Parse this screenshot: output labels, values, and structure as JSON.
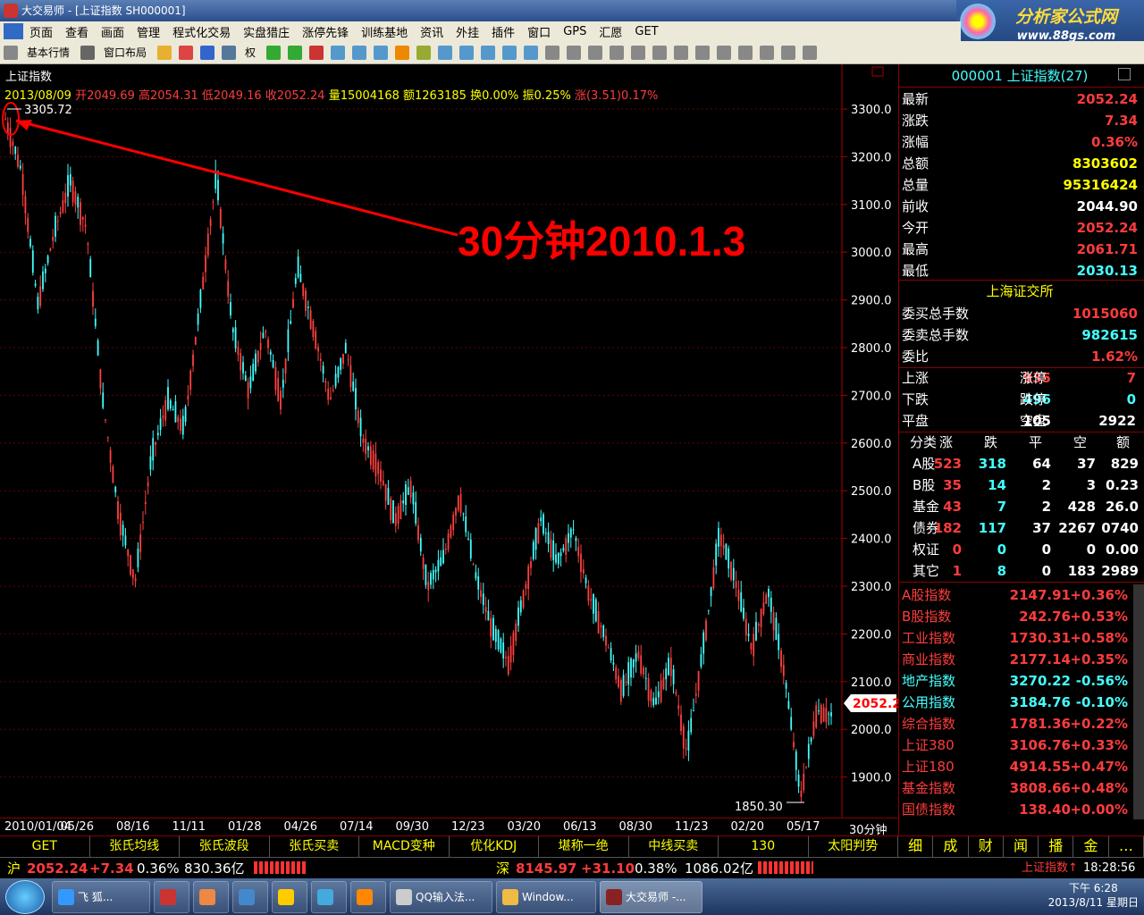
{
  "window": {
    "title": "大交易师 - [上证指数 SH000001]"
  },
  "logo": {
    "main": "分析家公式网",
    "url": "www.88gs.com"
  },
  "menu": [
    "页面",
    "查看",
    "画面",
    "管理",
    "程式化交易",
    "实盘猎庄",
    "涨停先锋",
    "训练基地",
    "资讯",
    "外挂",
    "插件",
    "窗口",
    "GPS",
    "汇愿",
    "GET"
  ],
  "toolbar": {
    "quotes": "基本行情",
    "layout": "窗口布局",
    "rights": "权"
  },
  "chart": {
    "title": "上证指数",
    "info": {
      "date": "2013/08/09",
      "open": "开2049.69",
      "high": "高2054.31",
      "low": "低2049.16",
      "close": "收2052.24",
      "vol": "量15004168",
      "amt": "额1263185",
      "turn": "换0.00%",
      "amp": "振0.25%",
      "chg": "涨(3.51)0.17%"
    },
    "annotation": "30分钟2010.1.3",
    "high_label": "3305.72",
    "low_label": "1850.30",
    "price_tag": "2052.2",
    "y_labels": [
      "3300.0",
      "3200.0",
      "3100.0",
      "3000.0",
      "2900.0",
      "2800.0",
      "2700.0",
      "2600.0",
      "2500.0",
      "2400.0",
      "2300.0",
      "2200.0",
      "2100.0",
      "2000.0",
      "1900.0"
    ],
    "x_labels": [
      "2010/01/04",
      "05/26",
      "08/16",
      "11/11",
      "01/28",
      "04/26",
      "07/14",
      "09/30",
      "12/23",
      "03/20",
      "06/13",
      "08/30",
      "11/23",
      "02/20",
      "05/17"
    ],
    "period": "30分钟"
  },
  "chart_data": {
    "type": "line",
    "title": "上证指数",
    "ylim": [
      1850,
      3320
    ],
    "x": [
      "2010/01/04",
      "05/26",
      "08/16",
      "11/11",
      "01/28",
      "04/26",
      "07/14",
      "09/30",
      "12/23",
      "03/20",
      "06/13",
      "08/30",
      "11/23",
      "02/20",
      "05/17"
    ],
    "series": [
      {
        "values": [
          3290,
          3180,
          2900,
          3050,
          3160,
          3060,
          2700,
          2460,
          2320,
          2580,
          2700,
          2640,
          2900,
          3170,
          2850,
          2720,
          2850,
          2700,
          2980,
          2850,
          2700,
          2810,
          2620,
          2560,
          2450,
          2520,
          2310,
          2370,
          2500,
          2330,
          2220,
          2150,
          2300,
          2450,
          2360,
          2430,
          2290,
          2200,
          2090,
          2170,
          2060,
          2150,
          1960,
          2180,
          2420,
          2320,
          2180,
          2300,
          2130,
          1870,
          2050,
          2040
        ]
      }
    ]
  },
  "right": {
    "header": "000001 上证指数(27)",
    "quote": [
      {
        "label": "最新",
        "value": "2052.24",
        "color": "red"
      },
      {
        "label": "涨跌",
        "value": "7.34",
        "color": "red"
      },
      {
        "label": "涨幅",
        "value": "0.36%",
        "color": "red"
      },
      {
        "label": "总额",
        "value": "8303602",
        "color": "yellow"
      },
      {
        "label": "总量",
        "value": "95316424",
        "color": "yellow"
      },
      {
        "label": "前收",
        "value": "2044.90",
        "color": "white"
      },
      {
        "label": "今开",
        "value": "2052.24",
        "color": "red"
      },
      {
        "label": "最高",
        "value": "2061.71",
        "color": "red"
      },
      {
        "label": "最低",
        "value": "2030.13",
        "color": "cyan"
      }
    ],
    "exchange": "上海证交所",
    "orders": [
      {
        "label": "委买总手数",
        "value": "1015060",
        "color": "red"
      },
      {
        "label": "委卖总手数",
        "value": "982615",
        "color": "cyan"
      },
      {
        "label": "委比",
        "value": "1.62%",
        "color": "red"
      }
    ],
    "breadth": [
      {
        "l1": "上涨",
        "v1": "935",
        "l2": "涨停",
        "v2": "7",
        "c": "red"
      },
      {
        "l1": "下跌",
        "v1": "496",
        "l2": "跌停",
        "v2": "0",
        "c": "cyan"
      },
      {
        "l1": "平盘",
        "v1": "105",
        "l2": "空盘",
        "v2": "2922",
        "c": "white"
      }
    ],
    "cat_headers": [
      "分类",
      "涨",
      "跌",
      "平",
      "空",
      "额"
    ],
    "cats": [
      [
        "A股",
        "523",
        "318",
        "64",
        "37",
        "829"
      ],
      [
        "B股",
        "35",
        "14",
        "2",
        "3",
        "0.23"
      ],
      [
        "基金",
        "43",
        "7",
        "2",
        "428",
        "26.0"
      ],
      [
        "债券",
        "182",
        "117",
        "37",
        "2267",
        "0740"
      ],
      [
        "权证",
        "0",
        "0",
        "0",
        "0",
        "0.00"
      ],
      [
        "其它",
        "1",
        "8",
        "0",
        "183",
        "2989"
      ]
    ],
    "indices": [
      {
        "name": "A股指数",
        "value": "2147.91",
        "pct": "+0.36%",
        "pc": "red"
      },
      {
        "name": "B股指数",
        "value": "242.76",
        "pct": "+0.53%",
        "pc": "red"
      },
      {
        "name": "工业指数",
        "value": "1730.31",
        "pct": "+0.58%",
        "pc": "red"
      },
      {
        "name": "商业指数",
        "value": "2177.14",
        "pct": "+0.35%",
        "pc": "red"
      },
      {
        "name": "地产指数",
        "value": "3270.22",
        "pct": "-0.56%",
        "pc": "cyan"
      },
      {
        "name": "公用指数",
        "value": "3184.76",
        "pct": "-0.10%",
        "pc": "cyan"
      },
      {
        "name": "综合指数",
        "value": "1781.36",
        "pct": "+0.22%",
        "pc": "red"
      },
      {
        "name": "上证380",
        "value": "3106.76",
        "pct": "+0.33%",
        "pc": "red"
      },
      {
        "name": "上证180",
        "value": "4914.55",
        "pct": "+0.47%",
        "pc": "red"
      },
      {
        "name": "基金指数",
        "value": "3808.66",
        "pct": "+0.48%",
        "pc": "red"
      },
      {
        "name": "国债指数",
        "value": "138.40",
        "pct": "+0.00%",
        "pc": "red"
      }
    ],
    "tabs": [
      "细",
      "成",
      "财",
      "闻",
      "播",
      "金",
      "…"
    ]
  },
  "funcbar": [
    "GET",
    "张氏均线",
    "张氏波段",
    "张氏买卖",
    "MACD变种",
    "优化KDJ",
    "堪称一绝",
    "中线买卖",
    "130",
    "太阳判势"
  ],
  "status": {
    "sh_label": "沪",
    "sh": "2052.24",
    "sh_chg": "+7.34",
    "sh_pct": "0.36%",
    "sh_amt": "830.36亿",
    "sz_label": "深",
    "sz": "8145.97",
    "sz_chg": "+31.10",
    "sz_pct": "0.38%",
    "sz_amt": "1086.02亿",
    "stock": "上证指数↑",
    "time": "18:28:56"
  },
  "taskbar": {
    "items": [
      "飞 狐...",
      "QQ输入法...",
      "Window...",
      "大交易师 -..."
    ],
    "time": "下午 6:28",
    "date": "2013/8/11 星期日"
  }
}
